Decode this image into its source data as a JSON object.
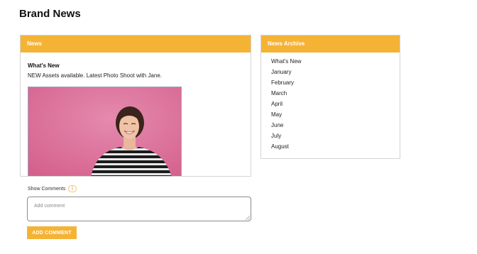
{
  "page": {
    "title": "Brand News"
  },
  "news": {
    "header": "News",
    "heading": "What's New",
    "body": "NEW Assets available. Latest Photo Shoot with Jane."
  },
  "archive": {
    "header": "News Archive",
    "items": [
      "What's New",
      "January",
      "February",
      "March",
      "April",
      "May",
      "June",
      "July",
      "August"
    ]
  },
  "comments": {
    "show_label": "Show Comments",
    "count": "1",
    "placeholder": "Add comment",
    "button_label": "ADD COMMENT"
  },
  "colors": {
    "accent": "#f5b335",
    "photo_background": "#dc6e98"
  }
}
